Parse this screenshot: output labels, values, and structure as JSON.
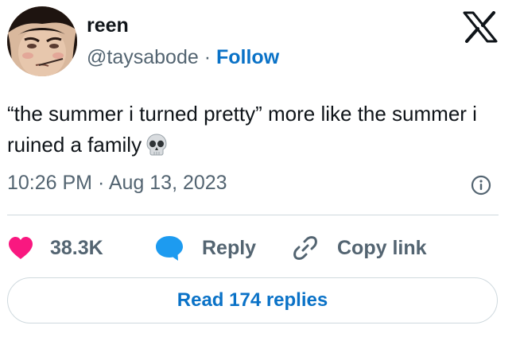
{
  "author": {
    "name": "reen",
    "handle": "@taysabode",
    "separator": "·",
    "follow_label": "Follow"
  },
  "tweet": {
    "text": "“the summer i turned pretty” more like the summer i ruined a family",
    "emoji": "skull-emoji",
    "time": "10:26 PM · Aug 13, 2023"
  },
  "actions": {
    "likes": "38.3K",
    "reply_label": "Reply",
    "copy_label": "Copy link"
  },
  "read_replies_label": "Read 174 replies",
  "icons": {
    "logo": "x-logo-icon",
    "info": "info-icon",
    "like": "heart-icon",
    "reply": "speech-bubble-icon",
    "copy": "link-icon"
  },
  "colors": {
    "like": "#f91880",
    "reply": "#1d9bf0",
    "link": "#0a72c7",
    "muted": "#536471",
    "text": "#0f1419",
    "border": "#cfd9de"
  }
}
